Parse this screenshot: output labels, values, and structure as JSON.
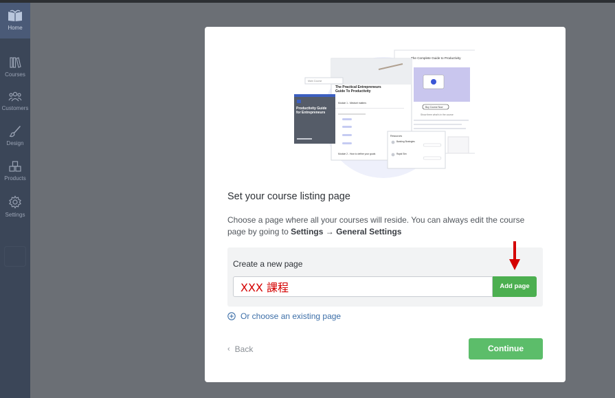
{
  "sidebar": {
    "items": [
      {
        "label": "Home",
        "icon": "home-book-icon"
      },
      {
        "label": "Courses",
        "icon": "courses-icon"
      },
      {
        "label": "Customers",
        "icon": "customers-icon"
      },
      {
        "label": "Design",
        "icon": "design-brush-icon"
      },
      {
        "label": "Products",
        "icon": "products-icon"
      },
      {
        "label": "Settings",
        "icon": "settings-gear-icon"
      }
    ]
  },
  "modal": {
    "illustration": {
      "badge": "Main Course",
      "card1_title": "The Practical Entrepreneurs Guide To Productivity",
      "card1_module1": "Module 1 - Mindset matters",
      "card1_module2": "Module 2 - How to define your goals",
      "card2_title": "Productivity Guide for Entrepreneurs",
      "card3_title": "The Complete Guide to Productivity",
      "card3_button": "Buy Course Now",
      "card3_caption": "Show them what's in the course",
      "card4_title": "Resources",
      "card4_item1": "Banking Strategies",
      "card4_item2": "Rapid Sim"
    },
    "title": "Set your course listing page",
    "description_text": "Choose a page where all your courses will reside. You can always edit the course page by going to ",
    "description_path": "Settings → General Settings",
    "create": {
      "label": "Create a new page",
      "input_value": "XXX 課程",
      "add_button": "Add page"
    },
    "choose_existing": "Or choose an existing page",
    "back": "Back",
    "continue": "Continue"
  },
  "colors": {
    "sidebar_bg": "#3b4658",
    "overlay": "#6b6f75",
    "accent_green": "#4caf50",
    "annotation_red": "#d40000",
    "link_blue": "#3d6fa8"
  }
}
